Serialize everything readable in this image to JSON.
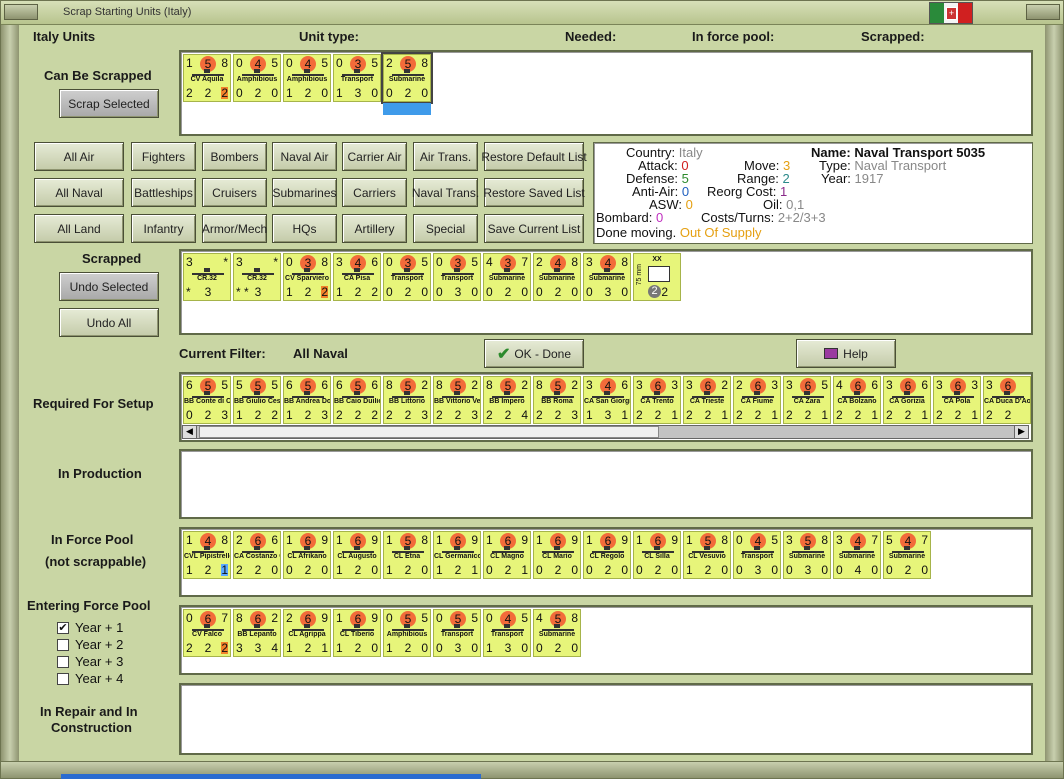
{
  "window": {
    "title": "Scrap Starting Units (Italy)"
  },
  "header": {
    "col1": "Italy Units",
    "col2": "Unit type:",
    "col3": "Needed:",
    "col4": "In force pool:",
    "col5": "Scrapped:"
  },
  "sections": {
    "can_be_scrapped": "Can Be Scrapped",
    "scrapped": "Scrapped",
    "current_filter_label": "Current Filter:",
    "current_filter_value": "All Naval",
    "required_for_setup": "Required For Setup",
    "in_production": "In Production",
    "in_force_pool": "In Force Pool",
    "not_scrappable": "(not scrappable)",
    "entering_force_pool": "Entering Force Pool",
    "in_repair_1": "In Repair and In",
    "in_repair_2": "Construction"
  },
  "buttons": {
    "scrap_selected": "Scrap Selected",
    "undo_selected": "Undo Selected",
    "undo_all": "Undo All",
    "ok_done": "OK - Done",
    "help": "Help",
    "all_air": "All Air",
    "fighters": "Fighters",
    "bombers": "Bombers",
    "naval_air": "Naval Air",
    "carrier_air": "Carrier Air",
    "air_trans": "Air Trans.",
    "restore_default": "Restore Default List",
    "all_naval": "All Naval",
    "battleships": "Battleships",
    "cruisers": "Cruisers",
    "submarines": "Submarines",
    "carriers": "Carriers",
    "naval_trans": "Naval Trans.",
    "restore_saved": "Restore Saved List",
    "all_land": "All Land",
    "infantry": "Infantry",
    "armor_mech": "Armor/Mech",
    "hqs": "HQs",
    "artillery": "Artillery",
    "special": "Special",
    "save_current": "Save Current List"
  },
  "info": {
    "country_label": "Country:",
    "country": "Italy",
    "attack_label": "Attack:",
    "attack": "0",
    "defense_label": "Defense:",
    "defense": "5",
    "antiair_label": "Anti-Air:",
    "antiair": "0",
    "asw_label": "ASW:",
    "asw": "0",
    "bombard_label": "Bombard:",
    "bombard": "0",
    "done_moving": "Done moving.",
    "supply": "Out Of Supply",
    "move_label": "Move:",
    "move": "3",
    "range_label": "Range:",
    "range": "2",
    "reorg_label": "Reorg Cost:",
    "reorg": "1",
    "oil_label": "Oil:",
    "oil": "0,1",
    "costs_label": "Costs/Turns:",
    "costs": "2+2/3+3",
    "name": "Name: Naval Transport 5035",
    "type_label": "Type:",
    "type": "Naval Transport",
    "year_label": "Year:",
    "year": "1917"
  },
  "entering": {
    "y1": "Year + 1",
    "y2": "Year + 2",
    "y3": "Year + 3",
    "y4": "Year + 4",
    "y1_check": "✔"
  },
  "units": {
    "can_be_scrapped": [
      [
        "1",
        "5",
        "8",
        "CV Aquila",
        "2",
        "2",
        "2",
        "o"
      ],
      [
        "0",
        "4",
        "5",
        "Amphibious",
        "0",
        "2",
        "0",
        ""
      ],
      [
        "0",
        "4",
        "5",
        "Amphibious",
        "1",
        "2",
        "0",
        ""
      ],
      [
        "0",
        "3",
        "5",
        "Transport",
        "1",
        "3",
        "0",
        ""
      ],
      [
        "2",
        "5",
        "8",
        "Submarine",
        "0",
        "2",
        "0",
        ""
      ]
    ],
    "scrapped": [
      [
        "3",
        "",
        "*",
        "CR.32",
        "*",
        "3",
        "",
        ""
      ],
      [
        "3",
        "",
        "*",
        "CR.32",
        "* *",
        "3",
        "",
        ""
      ],
      [
        "0",
        "3",
        "8",
        "CV Sparviero",
        "1",
        "2",
        "2",
        "o"
      ],
      [
        "3",
        "4",
        "6",
        "CA Pisa",
        "1",
        "2",
        "2",
        ""
      ],
      [
        "0",
        "3",
        "5",
        "Transport",
        "0",
        "2",
        "0",
        ""
      ],
      [
        "0",
        "3",
        "5",
        "Transport",
        "0",
        "3",
        "0",
        ""
      ],
      [
        "4",
        "3",
        "7",
        "Submarine",
        "0",
        "2",
        "0",
        ""
      ],
      [
        "2",
        "4",
        "8",
        "Submarine",
        "0",
        "2",
        "0",
        ""
      ],
      [
        "3",
        "4",
        "8",
        "Submarine",
        "0",
        "3",
        "0",
        ""
      ]
    ],
    "scrapped_art": {
      "top": "XX",
      "side": "75 mm",
      "bl": "2",
      "br": "2"
    },
    "required_for_setup": [
      [
        "6",
        "5",
        "5",
        "BB Conte di Cavour",
        "0",
        "2",
        "3",
        ""
      ],
      [
        "5",
        "5",
        "5",
        "BB Giulio Cesare",
        "1",
        "2",
        "2",
        ""
      ],
      [
        "6",
        "5",
        "6",
        "BB Andrea Doria",
        "1",
        "2",
        "3",
        ""
      ],
      [
        "6",
        "5",
        "6",
        "BB Caio Duilio",
        "2",
        "2",
        "2",
        ""
      ],
      [
        "8",
        "5",
        "2",
        "BB Littorio",
        "2",
        "2",
        "3",
        ""
      ],
      [
        "8",
        "5",
        "2",
        "BB Vittorio Veneto",
        "2",
        "2",
        "3",
        ""
      ],
      [
        "8",
        "5",
        "2",
        "BB Impero",
        "2",
        "2",
        "4",
        ""
      ],
      [
        "8",
        "5",
        "2",
        "BB Roma",
        "2",
        "2",
        "3",
        ""
      ],
      [
        "3",
        "4",
        "6",
        "CA San Giorgio",
        "1",
        "3",
        "1",
        ""
      ],
      [
        "3",
        "6",
        "3",
        "CA Trento",
        "2",
        "2",
        "1",
        ""
      ],
      [
        "3",
        "6",
        "2",
        "CA Trieste",
        "2",
        "2",
        "1",
        ""
      ],
      [
        "2",
        "6",
        "3",
        "CA Fiume",
        "2",
        "2",
        "1",
        ""
      ],
      [
        "3",
        "6",
        "5",
        "CA Zara",
        "2",
        "2",
        "1",
        ""
      ],
      [
        "4",
        "6",
        "6",
        "CA Bolzano",
        "2",
        "2",
        "1",
        ""
      ],
      [
        "3",
        "6",
        "6",
        "CA Gorizia",
        "2",
        "2",
        "1",
        ""
      ],
      [
        "3",
        "6",
        "3",
        "CA Pola",
        "2",
        "2",
        "1",
        ""
      ],
      [
        "3",
        "6",
        "",
        "CA Duca D'Aosta",
        "2",
        "2",
        "",
        ""
      ]
    ],
    "in_force_pool": [
      [
        "1",
        "4",
        "8",
        "CVL Pipistrello",
        "1",
        "2",
        "1",
        "b"
      ],
      [
        "2",
        "6",
        "6",
        "CA Costanzo Ciano",
        "2",
        "2",
        "0",
        ""
      ],
      [
        "1",
        "6",
        "9",
        "CL Afrikano",
        "0",
        "2",
        "0",
        ""
      ],
      [
        "1",
        "6",
        "9",
        "CL Augusto",
        "1",
        "2",
        "0",
        ""
      ],
      [
        "1",
        "5",
        "8",
        "CL Etna",
        "1",
        "2",
        "0",
        ""
      ],
      [
        "1",
        "6",
        "9",
        "CL Germanico",
        "1",
        "2",
        "1",
        ""
      ],
      [
        "1",
        "6",
        "9",
        "CL Magno",
        "0",
        "2",
        "1",
        ""
      ],
      [
        "1",
        "6",
        "9",
        "CL Mario",
        "0",
        "2",
        "0",
        ""
      ],
      [
        "1",
        "6",
        "9",
        "CL Regolo",
        "0",
        "2",
        "0",
        ""
      ],
      [
        "1",
        "6",
        "9",
        "CL Silla",
        "0",
        "2",
        "0",
        ""
      ],
      [
        "1",
        "5",
        "8",
        "CL Vesuvio",
        "1",
        "2",
        "0",
        ""
      ],
      [
        "0",
        "4",
        "5",
        "Transport",
        "0",
        "3",
        "0",
        ""
      ],
      [
        "3",
        "5",
        "8",
        "Submarine",
        "0",
        "3",
        "0",
        ""
      ],
      [
        "3",
        "4",
        "7",
        "Submarine",
        "0",
        "4",
        "0",
        ""
      ],
      [
        "5",
        "4",
        "7",
        "Submarine",
        "0",
        "2",
        "0",
        ""
      ]
    ],
    "entering_force_pool": [
      [
        "0",
        "6",
        "7",
        "CV Falco",
        "2",
        "2",
        "2",
        "o"
      ],
      [
        "8",
        "6",
        "2",
        "BB Lepanto",
        "3",
        "3",
        "4",
        ""
      ],
      [
        "2",
        "6",
        "9",
        "CL Agrippa",
        "1",
        "2",
        "1",
        ""
      ],
      [
        "1",
        "6",
        "9",
        "CL Tiberio",
        "1",
        "2",
        "0",
        ""
      ],
      [
        "0",
        "5",
        "5",
        "Amphibious",
        "1",
        "2",
        "0",
        ""
      ],
      [
        "0",
        "5",
        "5",
        "Transport",
        "0",
        "3",
        "0",
        ""
      ],
      [
        "0",
        "4",
        "5",
        "Transport",
        "1",
        "3",
        "0",
        ""
      ],
      [
        "4",
        "5",
        "8",
        "Submarine",
        "0",
        "2",
        "0",
        ""
      ]
    ]
  },
  "colors": {
    "bg": "#c9d6a4",
    "counter": "#e7f57a",
    "combat": "#f26b3a",
    "green": "#2c8a2c",
    "orange": "#e5a012",
    "purple": "#8a2a8a",
    "blue": "#2060c0",
    "red": "#d02020"
  }
}
